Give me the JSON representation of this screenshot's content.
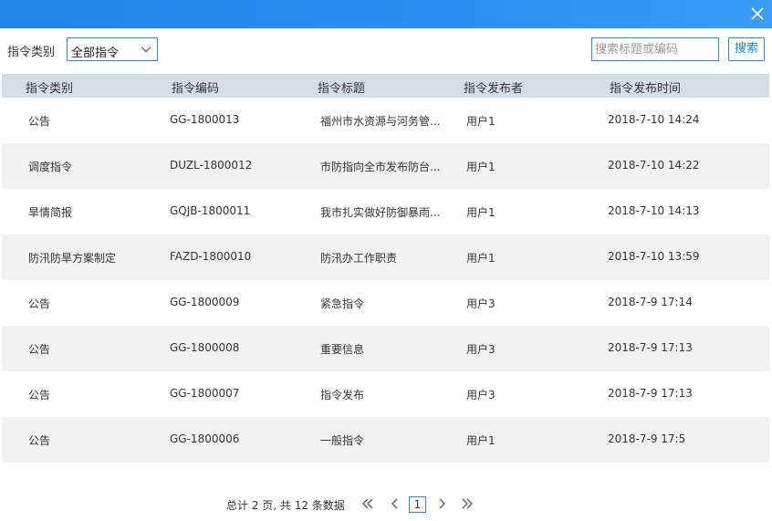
{
  "window": {
    "close_icon": "close-icon"
  },
  "toolbar": {
    "category_label": "指令类别",
    "category_selected": "全部指令",
    "search_placeholder": "搜索标题或编码",
    "search_button": "搜索"
  },
  "table": {
    "headers": [
      "指令类别",
      "指令编码",
      "指令标题",
      "指令发布者",
      "指令发布时间"
    ],
    "rows": [
      [
        "公告",
        "GG-1800013",
        "福州市水资源与河务管...",
        "用户1",
        "2018-7-10 14:24"
      ],
      [
        "调度指令",
        "DUZL-1800012",
        "市防指向全市发布防台...",
        "用户1",
        "2018-7-10 14:22"
      ],
      [
        "旱情简报",
        "GQJB-1800011",
        "我市扎实做好防御暴雨...",
        "用户1",
        "2018-7-10 14:13"
      ],
      [
        "防汛防旱方案制定",
        "FAZD-1800010",
        "防汛办工作职责",
        "用户1",
        "2018-7-10 13:59"
      ],
      [
        "公告",
        "GG-1800009",
        "紧急指令",
        "用户3",
        "2018-7-9 17:14"
      ],
      [
        "公告",
        "GG-1800008",
        "重要信息",
        "用户3",
        "2018-7-9 17:13"
      ],
      [
        "公告",
        "GG-1800007",
        "指令发布",
        "用户3",
        "2018-7-9 17:13"
      ],
      [
        "公告",
        "GG-1800006",
        "一般指令",
        "用户1",
        "2018-7-9 17:5"
      ]
    ]
  },
  "pager": {
    "summary": "总计 2 页, 共 12 条数据",
    "current_page": "1"
  },
  "colors": {
    "titlebar": "#2a8ff0",
    "accent": "#2b8ad8",
    "header_bg": "#d5dee5",
    "alt_row": "#f2f2f2"
  }
}
